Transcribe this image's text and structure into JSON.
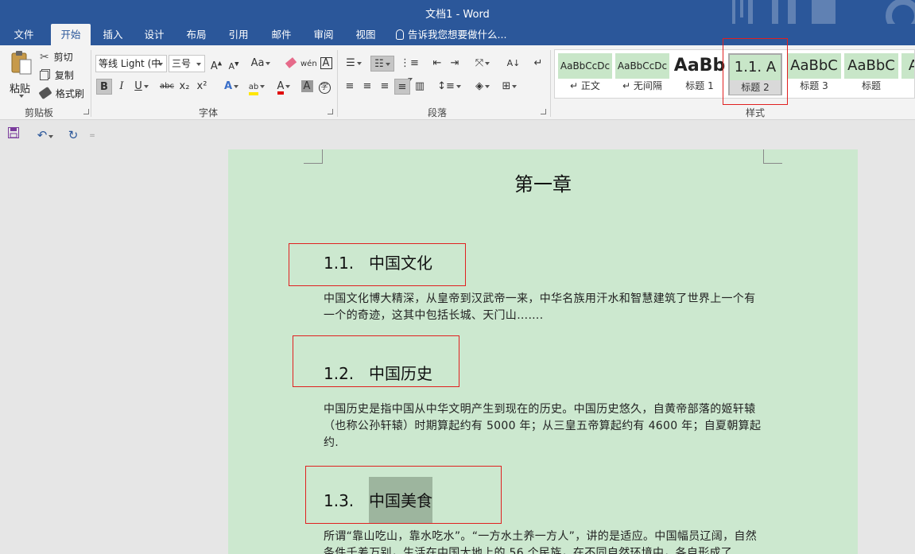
{
  "app": {
    "title": "文档1 - Word"
  },
  "tabs": [
    "文件",
    "开始",
    "插入",
    "设计",
    "布局",
    "引用",
    "邮件",
    "审阅",
    "视图"
  ],
  "tell_me": "告诉我您想要做什么...",
  "clipboard": {
    "paste": "粘贴",
    "cut": "剪切",
    "copy": "复制",
    "format_painter": "格式刷",
    "group_label": "剪贴板"
  },
  "font": {
    "font_name": "等线 Light (中",
    "font_size": "三号",
    "change_case": "Aa",
    "bold": "B",
    "italic": "I",
    "underline": "U",
    "strikethrough": "abc",
    "subscript": "x₂",
    "superscript": "x²",
    "group_label": "字体"
  },
  "paragraph": {
    "group_label": "段落"
  },
  "styles": {
    "group_label": "样式",
    "items": [
      {
        "preview": "AaBbCcDc",
        "name": "正文"
      },
      {
        "preview": "AaBbCcDc",
        "name": "无间隔"
      },
      {
        "preview": "AaBb",
        "name": "标题 1"
      },
      {
        "preview": "1.1.  A",
        "name": "标题 2"
      },
      {
        "preview": "AaBbC",
        "name": "标题 3"
      },
      {
        "preview": "AaBbC",
        "name": "标题"
      },
      {
        "preview": "A",
        "name": ""
      }
    ]
  },
  "document": {
    "chapter_title": "第一章",
    "sections": [
      {
        "number": "1.1.",
        "title": "中国文化",
        "body": "中国文化博大精深，从皇帝到汉武帝一来，中华名族用汗水和智慧建筑了世界上一个有一个的奇迹，这其中包括长城、天门山……."
      },
      {
        "number": "1.2.",
        "title": "中国历史",
        "body": "中国历史是指中国从中华文明产生到现在的历史。中国历史悠久，自黄帝部落的姬轩辕（也称公孙轩辕）时期算起约有 5000 年；从三皇五帝算起约有 4600 年；自夏朝算起约."
      },
      {
        "number": "1.3.",
        "title": "中国美食",
        "body": "所谓“靠山吃山，靠水吃水”。“一方水土养一方人”，讲的是适应。中国幅员辽阔，自然条件千差万别，生活在中国大地上的 56 个民族，在不同自然环境中，各自形成了"
      }
    ]
  },
  "colors": {
    "title_bar": "#2b579a",
    "page_background": "#cce8cf",
    "highlight_box": "#e02020",
    "selection": "#9db59e"
  }
}
